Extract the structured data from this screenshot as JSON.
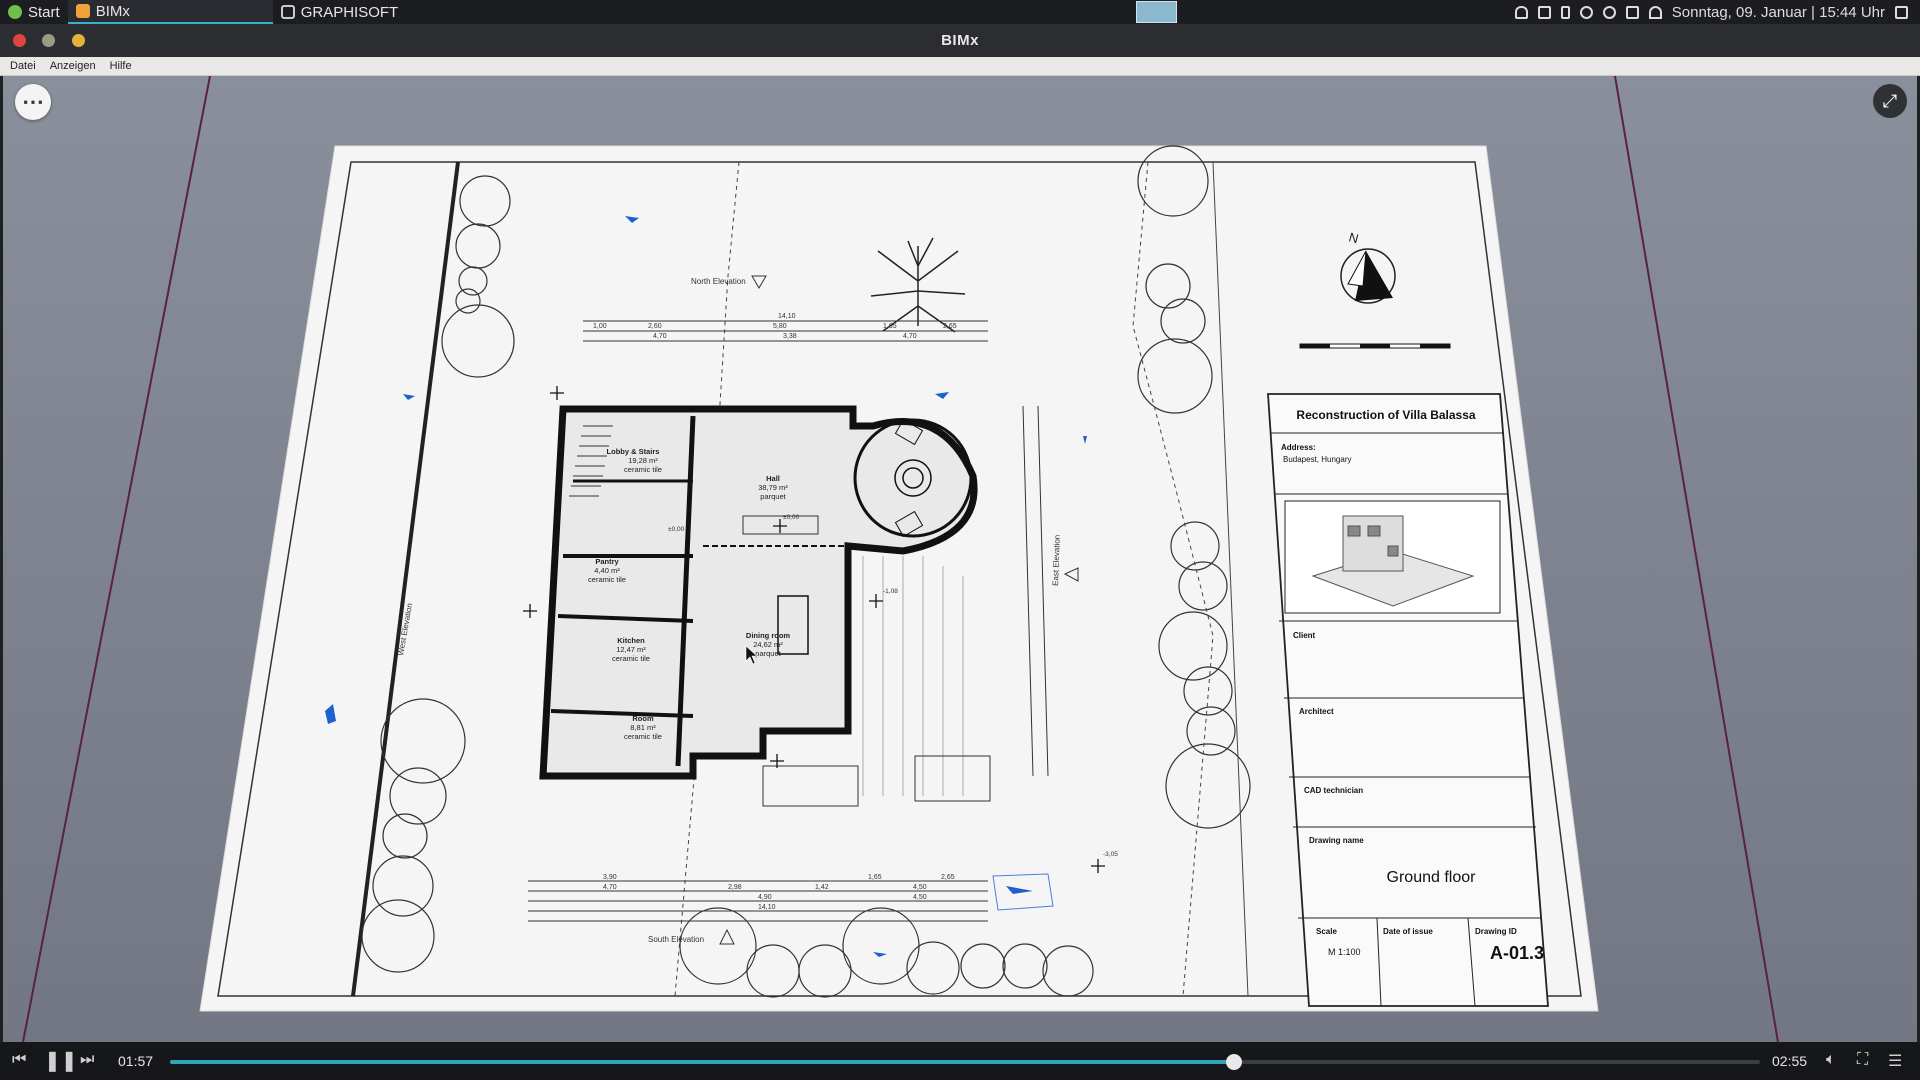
{
  "taskbar": {
    "start": "Start",
    "tasks": [
      {
        "label": "BIMx",
        "active": true
      },
      {
        "label": "GRAPHISOFT",
        "active": false
      }
    ],
    "datetime": "Sonntag, 09. Januar | 15:44 Uhr"
  },
  "window": {
    "title": "BIMx"
  },
  "menu": {
    "items": [
      "Datei",
      "Anzeigen",
      "Hilfe"
    ]
  },
  "drawing": {
    "title_block": {
      "project": "Reconstruction of Villa Balassa",
      "address_label": "Address:",
      "address": "Budapest, Hungary",
      "client_label": "Client",
      "architect_label": "Architect",
      "cad_label": "CAD technician",
      "drawing_name_label": "Drawing name",
      "drawing_name": "Ground floor",
      "scale_label": "Scale",
      "scale": "M 1:100",
      "date_label": "Date of issue",
      "id_label": "Drawing ID",
      "id": "A-01.3"
    },
    "labels": {
      "north_elev": "North Elevation",
      "south_elev": "South Elevation",
      "east_elev": "East Elevation",
      "west_elev": "West Elevation",
      "compass": "N",
      "rooms": [
        {
          "name": "Lobby & Stairs",
          "area": "19,28 m²",
          "finish": "ceramic tile"
        },
        {
          "name": "Hall",
          "area": "38,79 m²",
          "finish": "parquet"
        },
        {
          "name": "Pantry",
          "area": "4,40 m²",
          "finish": "ceramic tile"
        },
        {
          "name": "Kitchen",
          "area": "12,47 m²",
          "finish": "ceramic tile"
        },
        {
          "name": "Dining room",
          "area": "24,62 m²",
          "finish": "parquet"
        },
        {
          "name": "Room",
          "area": "8,81 m²",
          "finish": "ceramic tile"
        }
      ],
      "dims_top": [
        "14,10",
        "1,00",
        "2,60",
        "5,80",
        "1,65",
        "2,65",
        "4,70",
        "3,38",
        "4,70"
      ],
      "dims_bottom": [
        "3,90",
        "1,65",
        "2,65",
        "4,70",
        "2,98",
        "1,42",
        "4,50",
        "4,90",
        "4,50",
        "14,10"
      ],
      "levels": [
        "±0,00",
        "±0,00",
        "-1,08",
        "-3,05"
      ]
    }
  },
  "player": {
    "current": "01:57",
    "total": "02:55",
    "progress": 0.669
  },
  "colors": {
    "accent": "#2fa6b8"
  }
}
